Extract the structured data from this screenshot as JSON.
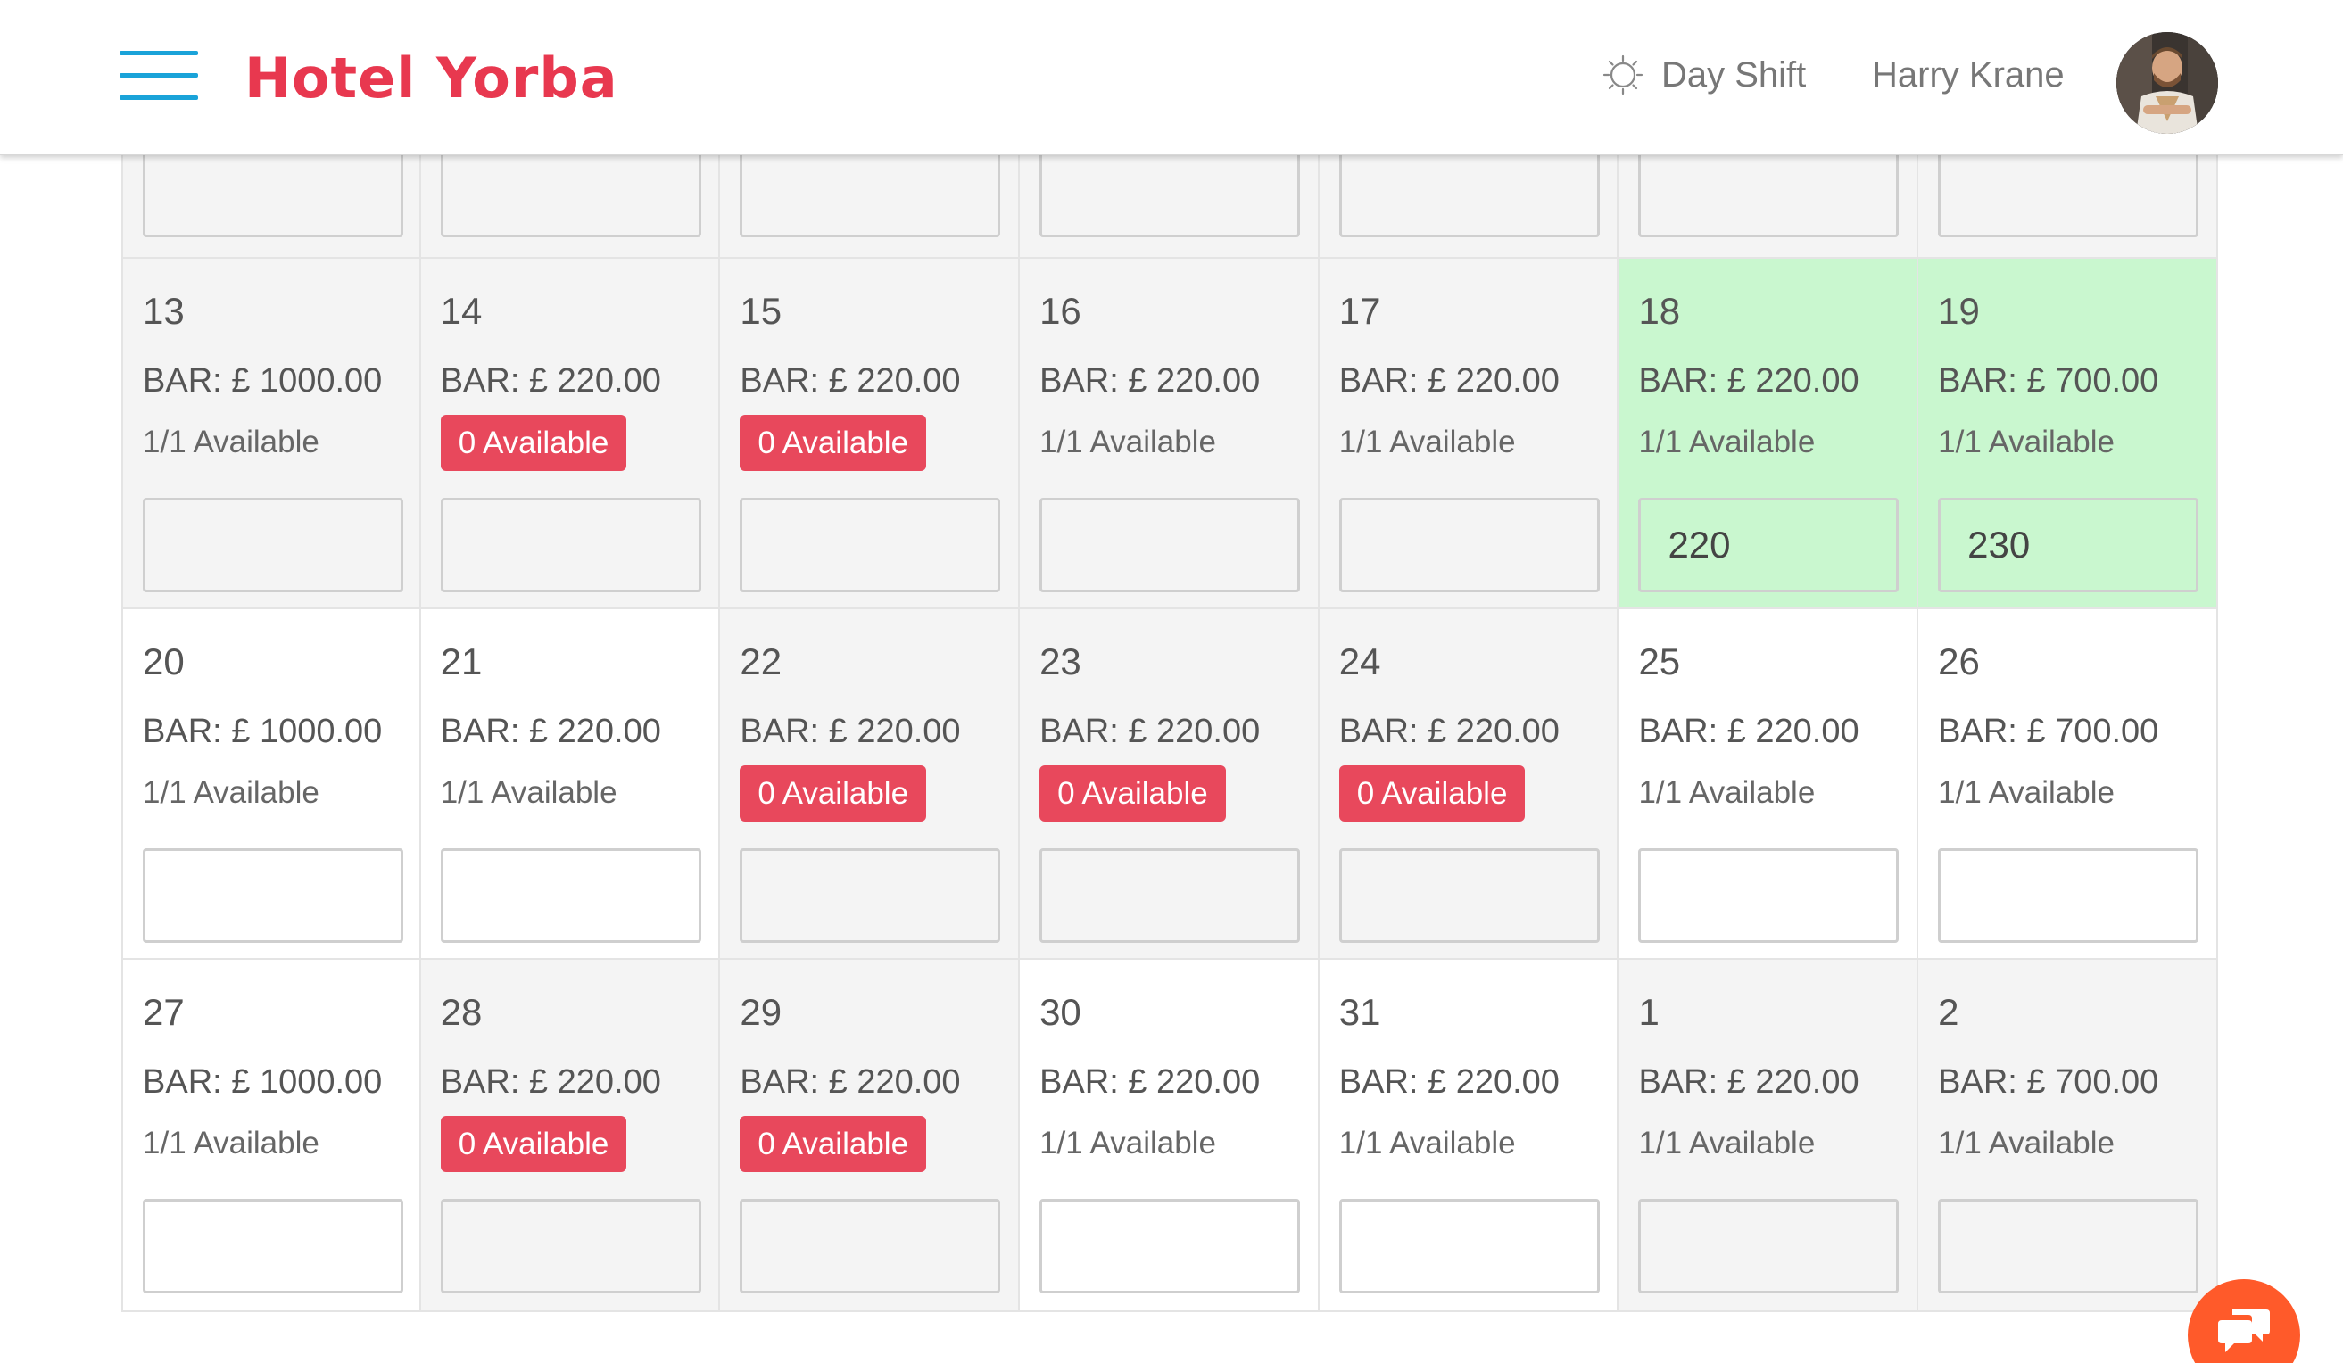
{
  "header": {
    "brand": "Hotel Yorba",
    "shift_label": "Day Shift",
    "user_name": "Harry Krane"
  },
  "colors": {
    "brand": "#e8384f",
    "menu_icon": "#1aa3d9",
    "badge_zero": "#e8485c",
    "highlight": "#c9f7cf",
    "chat_button": "#ff5a2a"
  },
  "calendar": {
    "partial_row": [
      {
        "bg": "grey",
        "input": ""
      },
      {
        "bg": "grey",
        "input": ""
      },
      {
        "bg": "grey",
        "input": ""
      },
      {
        "bg": "grey",
        "input": ""
      },
      {
        "bg": "grey",
        "input": ""
      },
      {
        "bg": "grey",
        "input": ""
      },
      {
        "bg": "grey",
        "input": ""
      }
    ],
    "weeks": [
      [
        {
          "day": "13",
          "bar": "BAR: £ 1000.00",
          "avail": "1/1 Available",
          "zero": false,
          "bg": "grey",
          "input": ""
        },
        {
          "day": "14",
          "bar": "BAR: £ 220.00",
          "avail": "0 Available",
          "zero": true,
          "bg": "grey",
          "input": ""
        },
        {
          "day": "15",
          "bar": "BAR: £ 220.00",
          "avail": "0 Available",
          "zero": true,
          "bg": "grey",
          "input": ""
        },
        {
          "day": "16",
          "bar": "BAR: £ 220.00",
          "avail": "1/1 Available",
          "zero": false,
          "bg": "grey",
          "input": ""
        },
        {
          "day": "17",
          "bar": "BAR: £ 220.00",
          "avail": "1/1 Available",
          "zero": false,
          "bg": "grey",
          "input": ""
        },
        {
          "day": "18",
          "bar": "BAR: £ 220.00",
          "avail": "1/1 Available",
          "zero": false,
          "bg": "green",
          "input": "220"
        },
        {
          "day": "19",
          "bar": "BAR: £ 700.00",
          "avail": "1/1 Available",
          "zero": false,
          "bg": "green",
          "input": "230"
        }
      ],
      [
        {
          "day": "20",
          "bar": "BAR: £ 1000.00",
          "avail": "1/1 Available",
          "zero": false,
          "bg": "white",
          "input": ""
        },
        {
          "day": "21",
          "bar": "BAR: £ 220.00",
          "avail": "1/1 Available",
          "zero": false,
          "bg": "white",
          "input": ""
        },
        {
          "day": "22",
          "bar": "BAR: £ 220.00",
          "avail": "0 Available",
          "zero": true,
          "bg": "grey",
          "input": ""
        },
        {
          "day": "23",
          "bar": "BAR: £ 220.00",
          "avail": "0 Available",
          "zero": true,
          "bg": "grey",
          "input": ""
        },
        {
          "day": "24",
          "bar": "BAR: £ 220.00",
          "avail": "0 Available",
          "zero": true,
          "bg": "grey",
          "input": ""
        },
        {
          "day": "25",
          "bar": "BAR: £ 220.00",
          "avail": "1/1 Available",
          "zero": false,
          "bg": "white",
          "input": ""
        },
        {
          "day": "26",
          "bar": "BAR: £ 700.00",
          "avail": "1/1 Available",
          "zero": false,
          "bg": "white",
          "input": ""
        }
      ],
      [
        {
          "day": "27",
          "bar": "BAR: £ 1000.00",
          "avail": "1/1 Available",
          "zero": false,
          "bg": "white",
          "input": ""
        },
        {
          "day": "28",
          "bar": "BAR: £ 220.00",
          "avail": "0 Available",
          "zero": true,
          "bg": "grey",
          "input": ""
        },
        {
          "day": "29",
          "bar": "BAR: £ 220.00",
          "avail": "0 Available",
          "zero": true,
          "bg": "grey",
          "input": ""
        },
        {
          "day": "30",
          "bar": "BAR: £ 220.00",
          "avail": "1/1 Available",
          "zero": false,
          "bg": "white",
          "input": ""
        },
        {
          "day": "31",
          "bar": "BAR: £ 220.00",
          "avail": "1/1 Available",
          "zero": false,
          "bg": "white",
          "input": ""
        },
        {
          "day": "1",
          "bar": "BAR: £ 220.00",
          "avail": "1/1 Available",
          "zero": false,
          "bg": "grey",
          "input": ""
        },
        {
          "day": "2",
          "bar": "BAR: £ 700.00",
          "avail": "1/1 Available",
          "zero": false,
          "bg": "grey",
          "input": ""
        }
      ]
    ]
  },
  "icons": {
    "menu": "hamburger-menu-icon",
    "shift": "sun-icon",
    "chat": "chat-icon"
  }
}
